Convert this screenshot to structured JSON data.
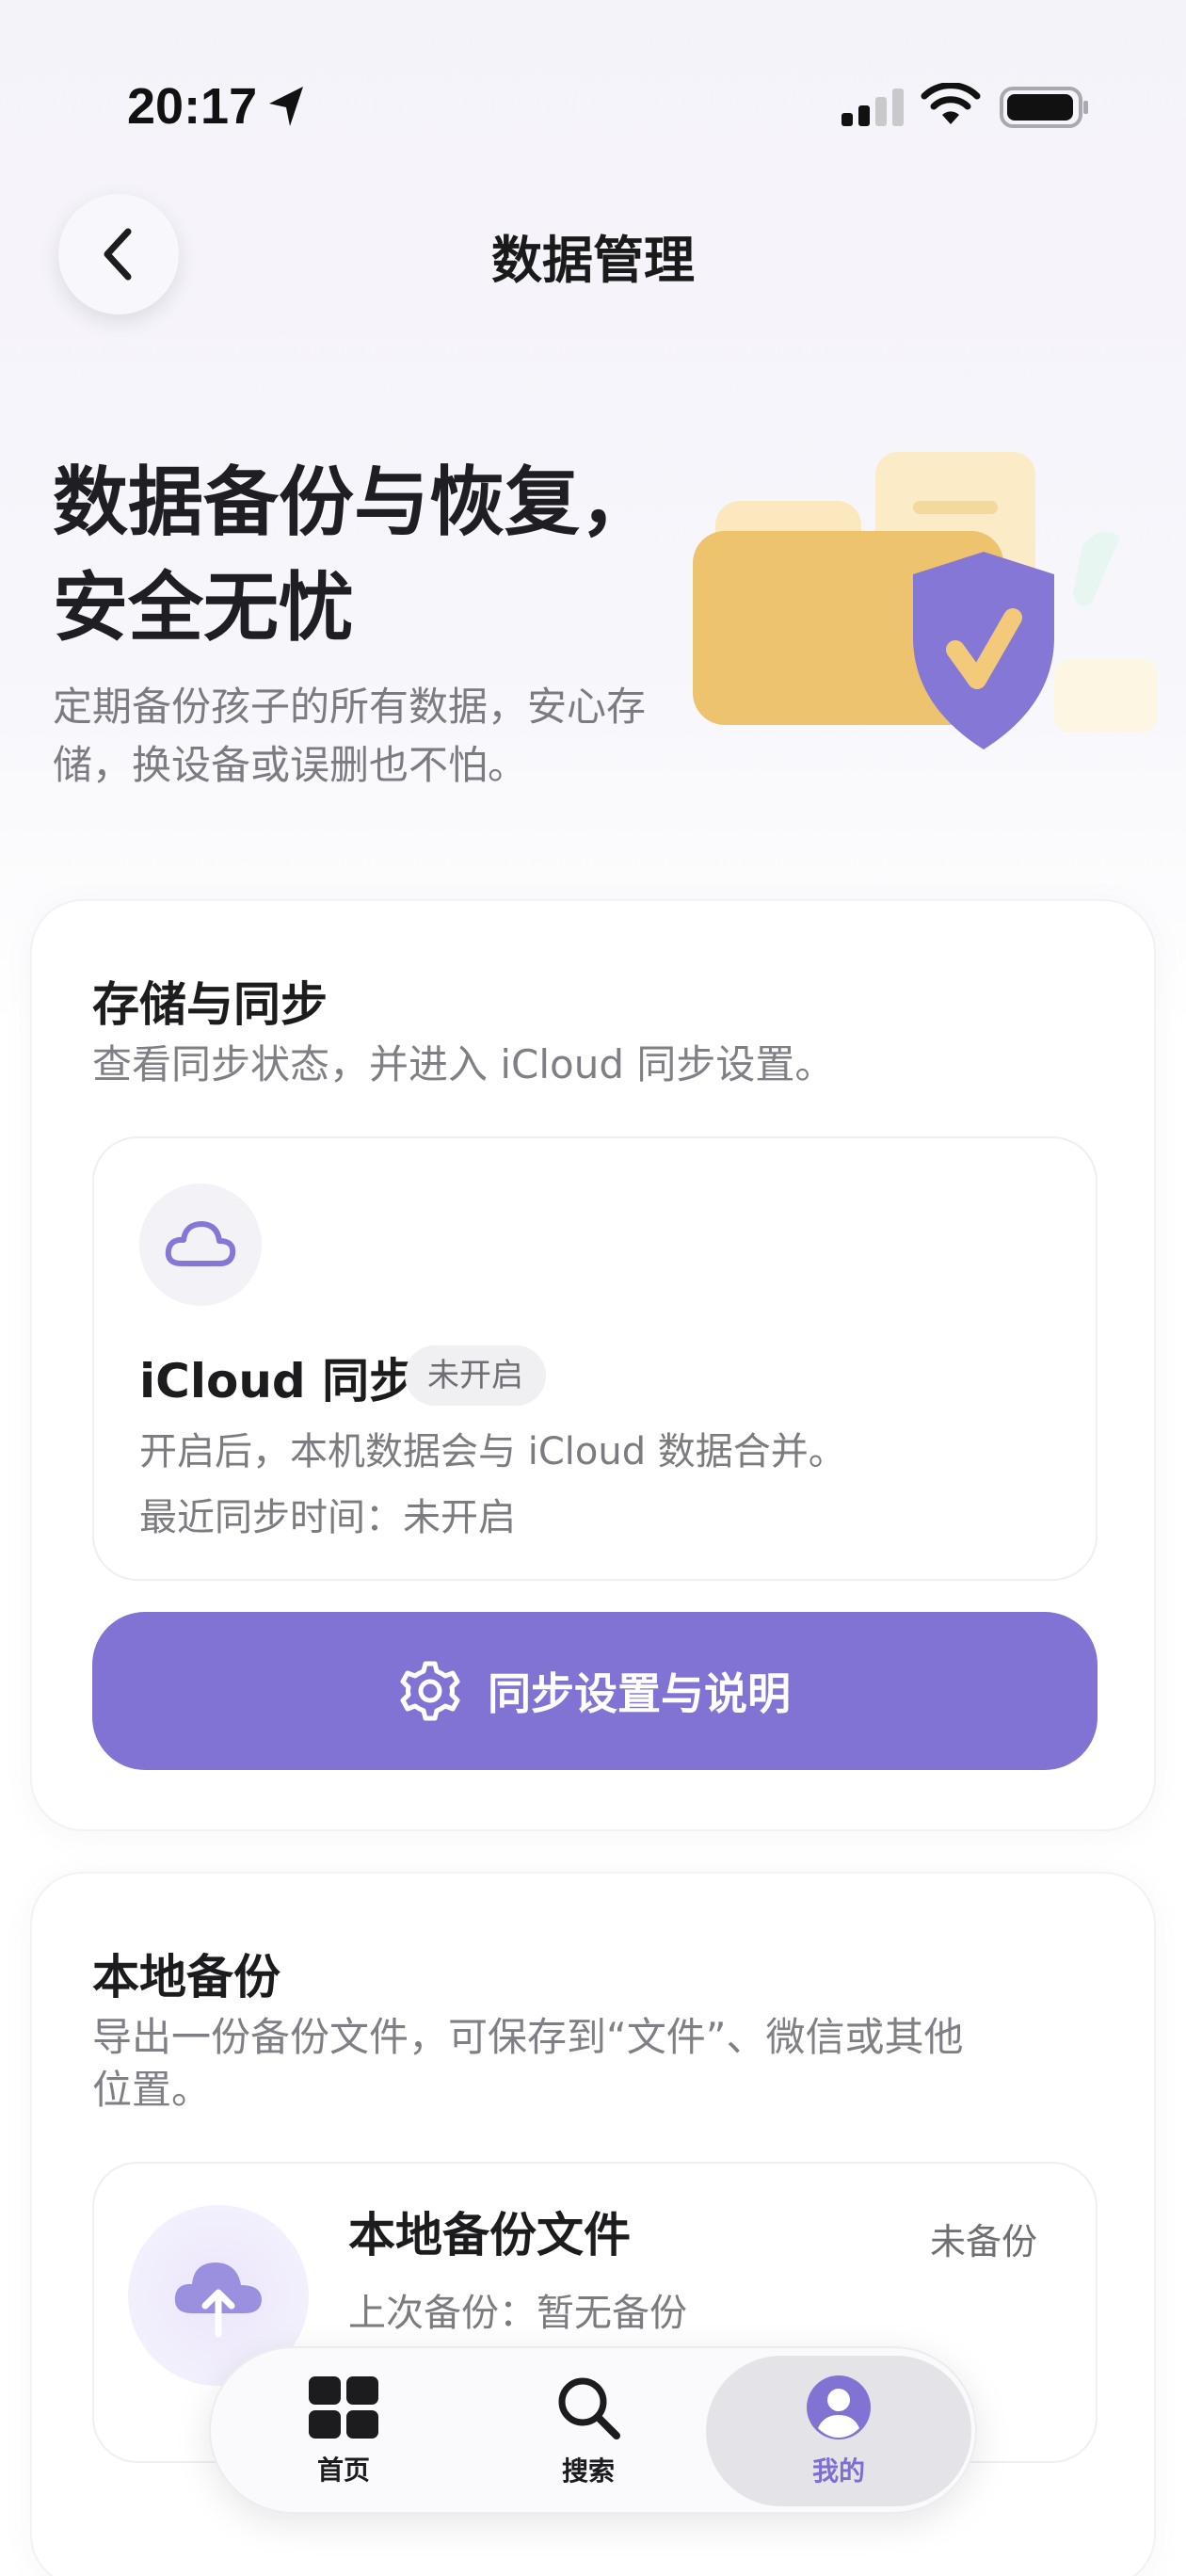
{
  "status_bar": {
    "time": "20:17"
  },
  "header": {
    "title": "数据管理"
  },
  "hero": {
    "title": "数据备份与恢复，安全无忧",
    "subtitle": "定期备份孩子的所有数据，安心存储，换设备或误删也不怕。"
  },
  "storage_card": {
    "title": "存储与同步",
    "subtitle": "查看同步状态，并进入 iCloud 同步设置。",
    "icloud": {
      "title": "iCloud 同步",
      "badge": "未开启",
      "description": "开启后，本机数据会与 iCloud 数据合并。",
      "last_sync": "最近同步时间：未开启"
    },
    "button_label": "同步设置与说明"
  },
  "local_card": {
    "title": "本地备份",
    "subtitle": "导出一份备份文件，可保存到“文件”、微信或其他位置。",
    "file": {
      "title": "本地备份文件",
      "status": "未备份",
      "last_backup": "上次备份：暂无备份"
    }
  },
  "tab_bar": {
    "items": [
      {
        "label": "首页",
        "icon": "grid-icon"
      },
      {
        "label": "搜索",
        "icon": "search-icon"
      },
      {
        "label": "我的",
        "icon": "person-icon"
      }
    ],
    "active_index": 2
  },
  "colors": {
    "accent": "#8073d4",
    "folder": "#edc36e",
    "shield": "#8577d6"
  }
}
